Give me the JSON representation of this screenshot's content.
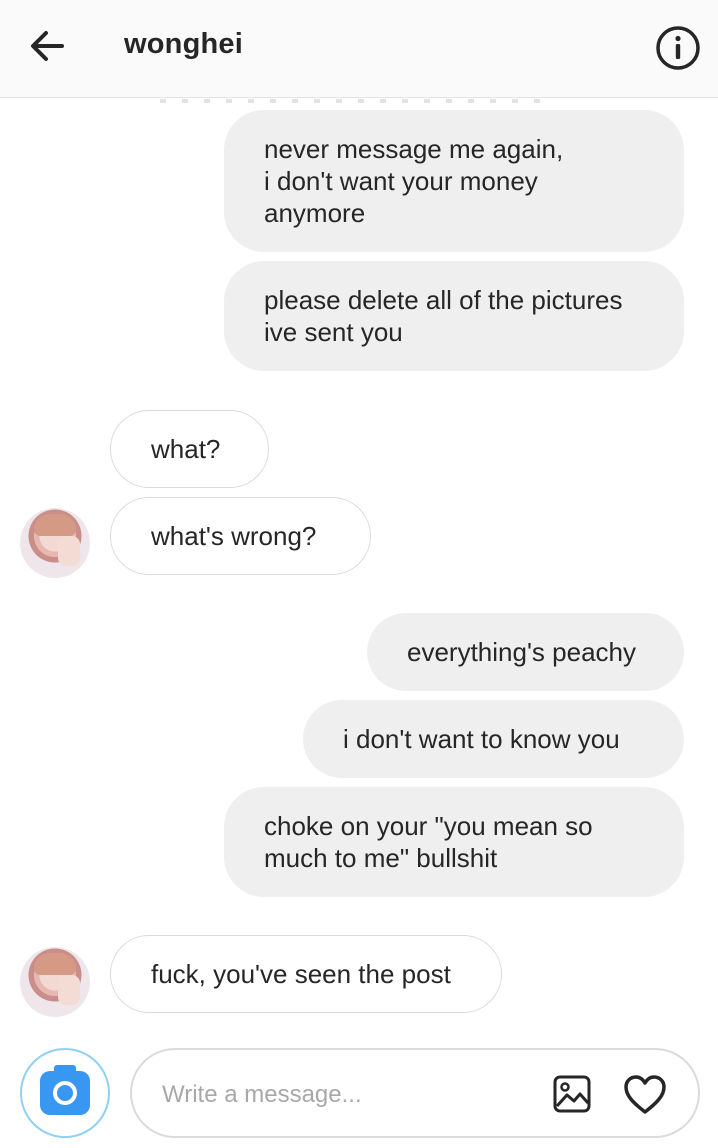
{
  "header": {
    "title": "wonghei",
    "back_icon": "arrow-left-icon",
    "info_icon": "info-circle-icon"
  },
  "messages": [
    {
      "from": "me",
      "lines": [
        "never message me again,",
        "i don't want your money",
        "anymore"
      ]
    },
    {
      "from": "me",
      "lines": [
        "please delete all of the pictures",
        "ive sent you"
      ]
    },
    {
      "from": "them",
      "lines": [
        "what?"
      ]
    },
    {
      "from": "them",
      "lines": [
        "what's wrong?"
      ]
    },
    {
      "from": "me",
      "lines": [
        "everything's peachy"
      ]
    },
    {
      "from": "me",
      "lines": [
        "i don't want to know you"
      ]
    },
    {
      "from": "me",
      "lines": [
        "choke on your \"you mean so",
        "much to me\" bullshit"
      ]
    },
    {
      "from": "them",
      "lines": [
        "fuck, you've seen the post"
      ]
    }
  ],
  "composer": {
    "placeholder": "Write a message...",
    "camera_icon": "camera-icon",
    "gallery_icon": "image-icon",
    "heart_icon": "heart-icon"
  },
  "colors": {
    "outgoing_bubble": "#efefef",
    "incoming_border": "#dbdbdb",
    "accent": "#3897f0"
  }
}
